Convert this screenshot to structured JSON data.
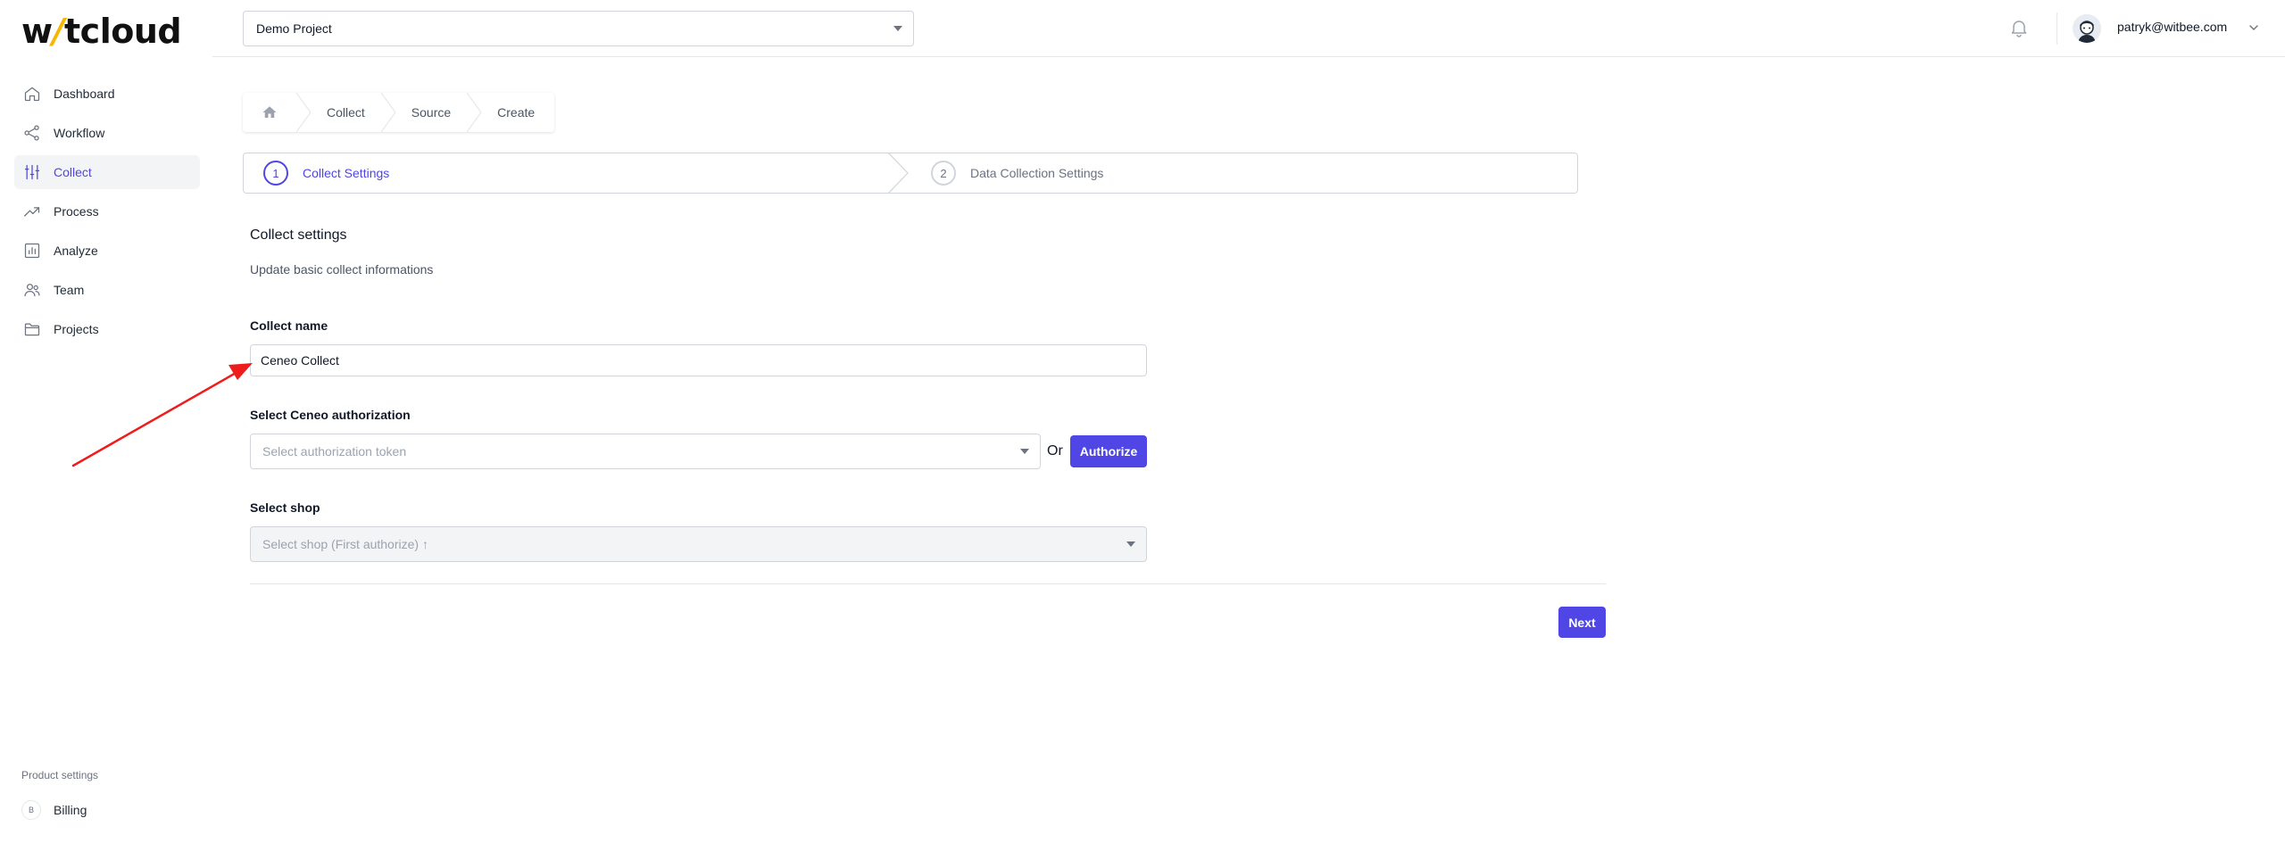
{
  "app": {
    "logo_left": "w",
    "logo_slash": "/",
    "logo_right": "tcloud"
  },
  "sidebar": {
    "items": [
      {
        "label": "Dashboard",
        "icon": "home-icon"
      },
      {
        "label": "Workflow",
        "icon": "share-icon"
      },
      {
        "label": "Collect",
        "icon": "sliders-icon",
        "active": true
      },
      {
        "label": "Process",
        "icon": "trending-icon"
      },
      {
        "label": "Analyze",
        "icon": "chart-icon"
      },
      {
        "label": "Team",
        "icon": "users-icon"
      },
      {
        "label": "Projects",
        "icon": "folder-icon"
      }
    ],
    "product_settings": "Product settings",
    "billing": "Billing",
    "billing_badge": "B"
  },
  "header": {
    "project": "Demo Project",
    "user_email": "patryk@witbee.com"
  },
  "breadcrumb": {
    "items": [
      "Collect",
      "Source",
      "Create"
    ]
  },
  "stepper": {
    "steps": [
      {
        "number": "1",
        "label": "Collect Settings"
      },
      {
        "number": "2",
        "label": "Data Collection Settings"
      }
    ]
  },
  "form": {
    "title": "Collect settings",
    "subtitle": "Update basic collect informations",
    "name_label": "Collect name",
    "name_value": "Ceneo Collect",
    "auth_label": "Select Ceneo authorization",
    "auth_placeholder": "Select authorization token",
    "or_text": "Or",
    "authorize_button": "Authorize",
    "shop_label": "Select shop",
    "shop_placeholder": "Select shop (First authorize) ↑",
    "next_button": "Next"
  },
  "colors": {
    "accent": "#4f46e5",
    "annotation_arrow": "#ee1c1c"
  }
}
